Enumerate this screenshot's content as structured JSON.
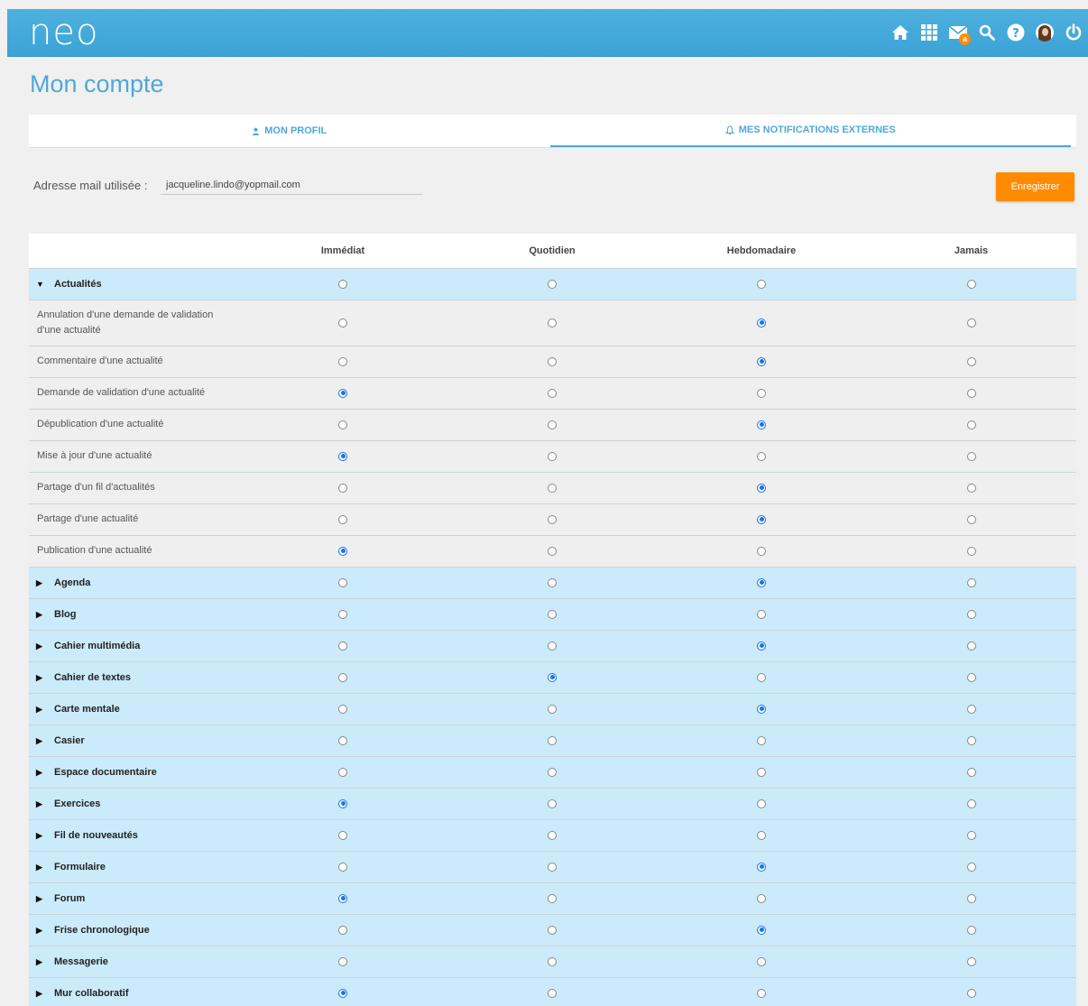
{
  "app": {
    "logo": "neo",
    "mail_badge": "a"
  },
  "topnav": {
    "icons": [
      "home-icon",
      "apps-grid-icon",
      "mail-icon",
      "search-icon",
      "help-icon",
      "avatar",
      "power-icon"
    ]
  },
  "page": {
    "title": "Mon compte"
  },
  "tabs": [
    {
      "label": "MON PROFIL",
      "icon": "user-icon"
    },
    {
      "label": "MES NOTIFICATIONS EXTERNES",
      "icon": "bell-icon",
      "active": true
    }
  ],
  "email": {
    "label": "Adresse mail utilisée :",
    "value": "jacqueline.lindo@yopmail.com"
  },
  "save_label": "Enregistrer",
  "colors": {
    "accent": "#4fa8d8",
    "save": "#ff8c00",
    "category_row": "#cbeafa",
    "checked": "#1a73e8"
  },
  "columns": [
    "Immédiat",
    "Quotidien",
    "Hebdomadaire",
    "Jamais"
  ],
  "rows": [
    {
      "type": "category",
      "label": "Actualités",
      "expanded": true,
      "selected": null
    },
    {
      "type": "item",
      "label": "Annulation d'une demande de validation d'une actualité",
      "selected": 2
    },
    {
      "type": "item",
      "label": "Commentaire d'une actualité",
      "selected": 2
    },
    {
      "type": "item",
      "label": "Demande de validation d'une actualité",
      "selected": 0
    },
    {
      "type": "item",
      "label": "Dépublication d'une actualité",
      "selected": 2
    },
    {
      "type": "item",
      "label": "Mise à jour d'une actualité",
      "selected": 0
    },
    {
      "type": "item",
      "label": "Partage d'un fil d'actualités",
      "selected": 2
    },
    {
      "type": "item",
      "label": "Partage d'une actualité",
      "selected": 2
    },
    {
      "type": "item",
      "label": "Publication d'une actualité",
      "selected": 0
    },
    {
      "type": "category",
      "label": "Agenda",
      "expanded": false,
      "selected": 2
    },
    {
      "type": "category",
      "label": "Blog",
      "expanded": false,
      "selected": null
    },
    {
      "type": "category",
      "label": "Cahier multimédia",
      "expanded": false,
      "selected": 2
    },
    {
      "type": "category",
      "label": "Cahier de textes",
      "expanded": false,
      "selected": 1
    },
    {
      "type": "category",
      "label": "Carte mentale",
      "expanded": false,
      "selected": 2
    },
    {
      "type": "category",
      "label": "Casier",
      "expanded": false,
      "selected": null
    },
    {
      "type": "category",
      "label": "Espace documentaire",
      "expanded": false,
      "selected": null
    },
    {
      "type": "category",
      "label": "Exercices",
      "expanded": false,
      "selected": 0
    },
    {
      "type": "category",
      "label": "Fil de nouveautés",
      "expanded": false,
      "selected": null
    },
    {
      "type": "category",
      "label": "Formulaire",
      "expanded": false,
      "selected": 2
    },
    {
      "type": "category",
      "label": "Forum",
      "expanded": false,
      "selected": 0
    },
    {
      "type": "category",
      "label": "Frise chronologique",
      "expanded": false,
      "selected": 2
    },
    {
      "type": "category",
      "label": "Messagerie",
      "expanded": false,
      "selected": null
    },
    {
      "type": "category",
      "label": "Mur collaboratif",
      "expanded": false,
      "selected": 0
    }
  ]
}
